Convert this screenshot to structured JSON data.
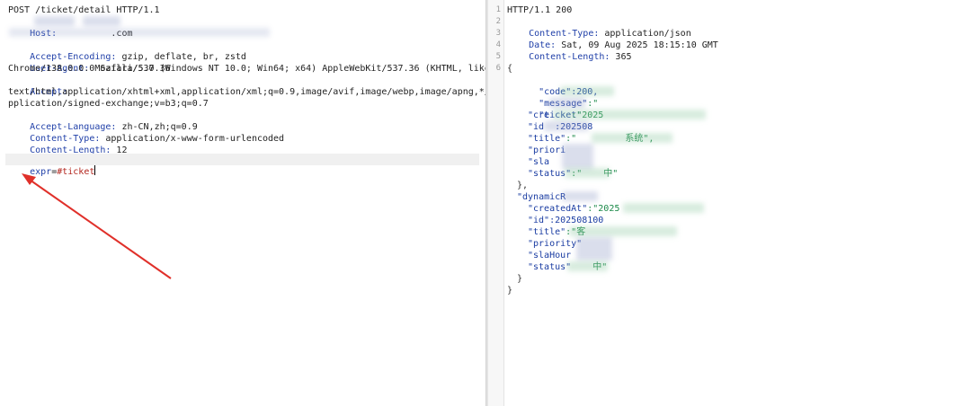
{
  "request": {
    "lines": [
      {
        "text": "POST /ticket/detail HTTP/1.1"
      },
      {
        "name": "Host:",
        "value": "          .com"
      },
      {
        "name": "",
        "value": ""
      },
      {
        "name": "Accept-Encoding:",
        "value": " gzip, deflate, br, zstd"
      },
      {
        "name": "User-Agent:",
        "value": " Mozilla/5.0 (Windows NT 10.0; Win64; x64) AppleWebKit/537.36 (KHTML, like Gecko)"
      },
      {
        "text": "Chrome/138.0.0.0 Safari/537.36"
      },
      {
        "name": "Accept:",
        "value": ""
      },
      {
        "text": "text/html,application/xhtml+xml,application/xml;q=0.9,image/avif,image/webp,image/apng,*/*;q=0.8,a"
      },
      {
        "text": "pplication/signed-exchange;v=b3;q=0.7"
      },
      {
        "name": "Accept-Language:",
        "value": " zh-CN,zh;q=0.9"
      },
      {
        "name": "Content-Type:",
        "value": " application/x-www-form-urlencoded"
      },
      {
        "name": "Content-Length:",
        "value": " 12"
      }
    ],
    "body_key": "expr",
    "body_eq": "=",
    "body_value": "#ticket"
  },
  "response": {
    "line_numbers": [
      "1",
      "2",
      "3",
      "4",
      "5",
      "6"
    ],
    "status": "HTTP/1.1 200",
    "ct_name": "Content-Type:",
    "ct_value": " application/json",
    "date_name": "Date:",
    "date_value": " Sat, 09 Aug 2025 18:15:10 GMT",
    "cl_name": "Content-Length:",
    "cl_value": " 365",
    "json": {
      "open": "{",
      "code_key": "\"code\"",
      "code_val": ":200,",
      "message_key": "\"message\"",
      "message_val": ":\"",
      "ticket_key": "\"ticket\"",
      "ticket_fields": [
        {
          "key": "\"cre",
          "val": "    :\"2025"
        },
        {
          "key": "\"id",
          "val": "  :202508"
        },
        {
          "key": "\"title\"",
          "val": ":\"         系统\","
        },
        {
          "key": "\"priori",
          "val": ""
        },
        {
          "key": "\"sla",
          "val": ""
        },
        {
          "key": "\"status\"",
          "val": ":\"    中\""
        }
      ],
      "close_obj": "},",
      "dyn_key": "\"dynamicR",
      "dyn_fields": [
        {
          "key": "\"createdAt\"",
          "val": ":\"2025"
        },
        {
          "key": "\"id\"",
          "val": ":202508100"
        },
        {
          "key": "\"title\"",
          "val": ":\"客"
        },
        {
          "key": "\"priority\"",
          "val": ""
        },
        {
          "key": "\"slaHour",
          "val": ""
        },
        {
          "key": "\"status\"",
          "val": "    中\""
        }
      ],
      "close_inner": "}",
      "close": "}"
    }
  }
}
